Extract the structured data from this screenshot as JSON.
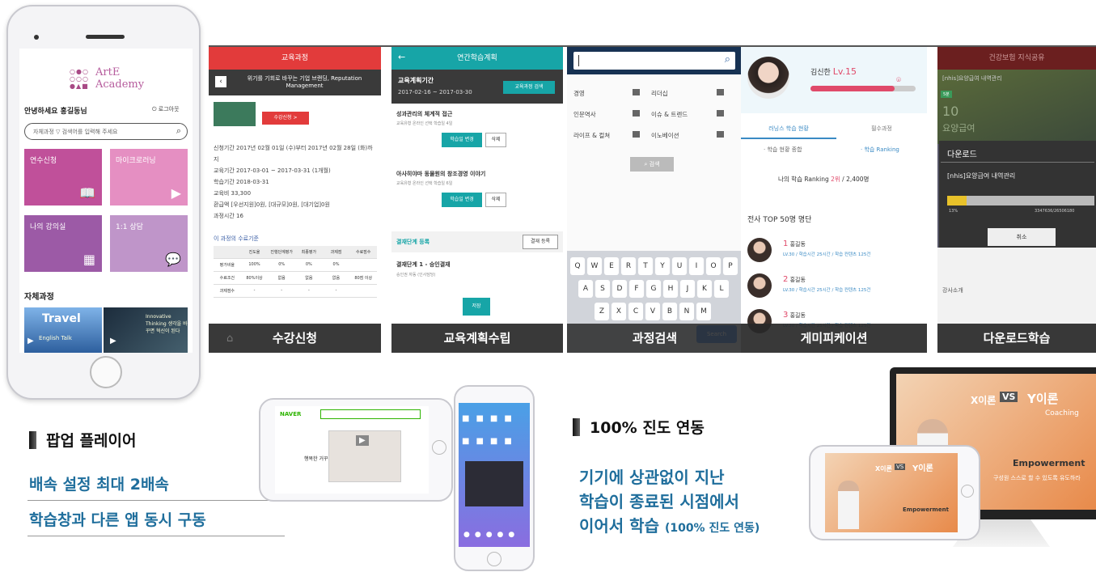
{
  "phone": {
    "logo_name": "ArtE\nAcademy",
    "greeting": "안녕하세요 홍길동님",
    "logout": "로그아웃",
    "search_filter": "자체과정",
    "search_placeholder": "검색어를 입력해 주세요",
    "tiles": [
      {
        "label": "연수신청",
        "icon": "book-icon",
        "color": "#c0509a"
      },
      {
        "label": "마이크로러닝",
        "icon": "video-icon",
        "color": "#e58fc2"
      },
      {
        "label": "나의 강의실",
        "icon": "calendar-icon",
        "color": "#9c5aa6"
      },
      {
        "label": "1:1 상담",
        "icon": "chat-icon",
        "color": "#bf95c9"
      }
    ],
    "section_title": "자체과정",
    "thumb1_title": "Travel",
    "thumb1_sub": "English Talk",
    "thumb2_text": "Innovative Thinking 생각을 바꾸면 혁신이 된다"
  },
  "shots": [
    {
      "caption": "수강신청",
      "header": "교육과정",
      "title": "위기를 기회로 바꾸는 기업 브랜딩, Reputation Management",
      "apply": "수강신청 >",
      "rows": [
        "신청기간 2017년 02월 01일 (수)부터 2017년 02월 28일 (화)까지",
        "교육기간 2017-03-01 ~ 2017-03-31 (1개월)",
        "학습기간 2018-03-31",
        "교육비 33,300",
        "환급액 [우선지원]0원, [대규모]0원, [대기업]0원",
        "과정시간 16"
      ],
      "section": "이 과정의 수료기준",
      "table_head": [
        "진도율",
        "진행단계평가",
        "최종평가",
        "과제점",
        "수료점수"
      ],
      "table_rows": [
        [
          "평가비율",
          "100%",
          "0%",
          "0%",
          "0%",
          ""
        ],
        [
          "수료조건",
          "80%이상",
          "없음",
          "없음",
          "없음",
          "80점 이상"
        ],
        [
          "과제점수",
          "-",
          "-",
          "-",
          "-",
          ""
        ]
      ]
    },
    {
      "caption": "교육계획수립",
      "header": "연간학습계획",
      "period_label": "교육계획기간",
      "period": "2017-02-16 ~ 2017-03-30",
      "search_btn": "교육과정 검색",
      "items": [
        {
          "title": "성과관리의 체계적 접근",
          "meta": "교육유형 온라인  선택 학습일 4일"
        },
        {
          "title": "아사히야마 동물원의 창조경영 이야기",
          "meta": "교육유형 온라인  선택 학습일 6일"
        }
      ],
      "change_btn": "학습일 변경",
      "delete_btn": "삭제",
      "approve_title": "결재단계 등록",
      "approve_btn": "결재 등록",
      "approve_step": "결재단계 1 - 승인결재",
      "approve_sub": "승인권 자동 (인사담당)",
      "save_btn": "저장"
    },
    {
      "caption": "과정검색",
      "categories": [
        [
          "경영",
          "리더십"
        ],
        [
          "인문역사",
          "이슈 & 트렌드"
        ],
        [
          "라이프 & 컬쳐",
          "이노베이션"
        ]
      ],
      "search_btn": "검색",
      "keys": [
        [
          "Q",
          "W",
          "E",
          "R",
          "T",
          "Y",
          "U",
          "I",
          "O",
          "P"
        ],
        [
          "A",
          "S",
          "D",
          "F",
          "G",
          "H",
          "J",
          "K",
          "L"
        ],
        [
          "Z",
          "X",
          "C",
          "V",
          "B",
          "N",
          "M"
        ]
      ],
      "search_key": "Search"
    },
    {
      "caption": "게미피케이션",
      "user": "김신한",
      "level": "Lv.15",
      "tabs": [
        "러닝스 학습 현황",
        "필수과정"
      ],
      "subtabs": [
        "학습 현황 종합",
        "학습 Ranking"
      ],
      "ranking_text": "나의 학습 Ranking",
      "rank": "2위",
      "total": "/ 2,400명",
      "list_title": "전사 TOP 50명 명단",
      "ranks": [
        {
          "no": "1",
          "name": "홍길동",
          "info": "LV.30 / 학습시간 25시간 / 학습 컨텐츠 125건"
        },
        {
          "no": "2",
          "name": "홍길동",
          "info": "LV.30 / 학습시간 25시간 / 학습 컨텐츠 125건"
        },
        {
          "no": "3",
          "name": "홍길동",
          "info": "LV.30 / 학습시간 25시간 / 학습 컨텐츠 125건"
        }
      ]
    },
    {
      "caption": "다운로드학습",
      "header": "건강보험 지식공유",
      "title": "[nhis]요양급여 내역관리",
      "badge": "5분",
      "big": "10",
      "big_sub": "요양급여",
      "dialog_title": "다운로드",
      "dialog_file": "[nhis]요양급여 내역관리",
      "progress_pct": "13%",
      "progress": 0.13,
      "bytes": "3347636/26506180",
      "cancel": "취소",
      "intro": "강사소개"
    }
  ],
  "popup": {
    "title": "팝업 플레이어",
    "line1": "배속 설정 최대 2배속",
    "line2": "학습창과 다른 앱 동시 구동",
    "naver": "NAVER",
    "video_title": "행복한 거꾸"
  },
  "sync": {
    "title": "100% 진도 연동",
    "line1": "기기에 상관없이 지난",
    "line2": "학습이 종료된 시점에서",
    "line3": "이어서 학습",
    "line3_small": "(100% 진도 연동)",
    "slide_x": "X이론",
    "slide_vs": "VS",
    "slide_y": "Y이론",
    "slide_coach": "Coaching",
    "slide_emp": "Empowerment",
    "slide_foot": "구성원 스스로 할 수 있도록 유도하라"
  }
}
